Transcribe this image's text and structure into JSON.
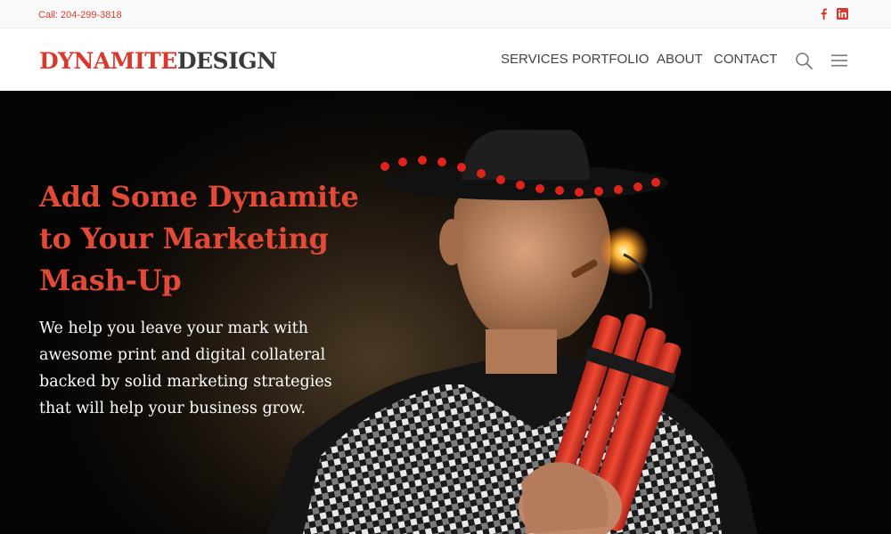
{
  "topbar": {
    "phone": "Call: 204-299-3818",
    "social": [
      {
        "icon": "facebook-icon",
        "glyph": "f"
      },
      {
        "icon": "linkedin-icon",
        "glyph": "in"
      }
    ]
  },
  "header": {
    "logo_primary": "DYNAMITE",
    "logo_secondary": "DESIGN",
    "nav": [
      "SERVICES",
      "PORTFOLIO",
      "ABOUT",
      "CONTACT"
    ],
    "icons": [
      "search-icon",
      "hamburger-menu-icon"
    ]
  },
  "hero": {
    "title_lines": [
      "Add Some Dynamite",
      "to Your Marketing",
      "Mash-Up"
    ],
    "subtitle_lines": [
      "We help you leave your mark with",
      "awesome print and digital collateral",
      "backed by solid marketing strategies",
      "that will help your business grow."
    ]
  },
  "colors": {
    "brand_red": "#d9392d",
    "hero_title": "#e24a36",
    "text_dark": "#3a3a3a",
    "hero_background": "#100c08"
  }
}
